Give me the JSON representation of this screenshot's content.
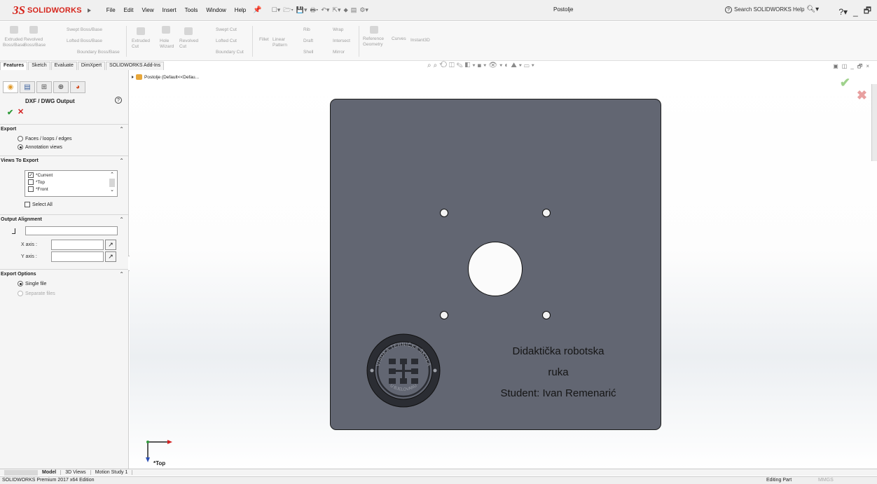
{
  "app": {
    "logo_ds": "3S",
    "logo_name": "SOLIDWORKS",
    "document_title": "Postolje",
    "search_placeholder": "Search SOLIDWORKS Help"
  },
  "menu": [
    "File",
    "Edit",
    "View",
    "Insert",
    "Tools",
    "Window",
    "Help"
  ],
  "ribbon": {
    "extruded_boss": "Extruded\nBoss/Base",
    "revolved_boss": "Revolved\nBoss/Base",
    "swept_boss": "Swept Boss/Base",
    "lofted_boss": "Lofted Boss/Base",
    "boundary_boss": "Boundary Boss/Base",
    "extruded_cut": "Extruded\nCut",
    "hole_wizard": "Hole\nWizard",
    "revolved_cut": "Revolved\nCut",
    "swept_cut": "Swept Cut",
    "lofted_cut": "Lofted Cut",
    "boundary_cut": "Boundary Cut",
    "fillet": "Fillet",
    "linear_pattern": "Linear\nPattern",
    "rib": "Rib",
    "draft": "Draft",
    "shell": "Shell",
    "wrap": "Wrap",
    "intersect": "Intersect",
    "mirror": "Mirror",
    "reference_geometry": "Reference\nGeometry",
    "curves": "Curves",
    "instant3d": "Instant3D"
  },
  "tabs": [
    "Features",
    "Sketch",
    "Evaluate",
    "DimXpert",
    "SOLIDWORKS Add-Ins"
  ],
  "panel": {
    "title": "DXF / DWG Output",
    "help": "?",
    "ok": "✔",
    "cancel": "✕",
    "export": {
      "title": "Export",
      "options": [
        {
          "label": "Faces / loops / edges",
          "selected": false
        },
        {
          "label": "Annotation views",
          "selected": true
        }
      ]
    },
    "views_to_export": {
      "title": "Views To Export",
      "items": [
        {
          "label": "*Current",
          "checked": true
        },
        {
          "label": "*Top",
          "checked": false
        },
        {
          "label": "*Front",
          "checked": false
        }
      ],
      "select_all": "Select All"
    },
    "output_alignment": {
      "title": "Output Alignment",
      "x_axis_label": "X axis :",
      "y_axis_label": "Y axis :"
    },
    "export_options": {
      "title": "Export Options",
      "options": [
        {
          "label": "Single file",
          "selected": true
        },
        {
          "label": "Separate files",
          "selected": false
        }
      ]
    }
  },
  "graphics": {
    "tree_root": "Postolje  (Default<<Defau...",
    "view_label": "*Top",
    "plate_text": {
      "line1": "Didaktička robotska",
      "line2": "ruka",
      "line3": "Student: Ivan Remenarić"
    },
    "seal_top": "VISOKA TEHNIČKA ŠKOLA",
    "seal_bottom": "U BJELOVARU"
  },
  "bottom_tabs": [
    "Model",
    "3D Views",
    "Motion Study 1"
  ],
  "status": {
    "left": "SOLIDWORKS Premium 2017 x64 Edition",
    "mode": "Editing Part",
    "units": "MMGS"
  },
  "colors": {
    "brand_red": "#d6251c",
    "plate": "#626672",
    "ok_green": "#2e9b3a",
    "cancel_red": "#d32020"
  }
}
